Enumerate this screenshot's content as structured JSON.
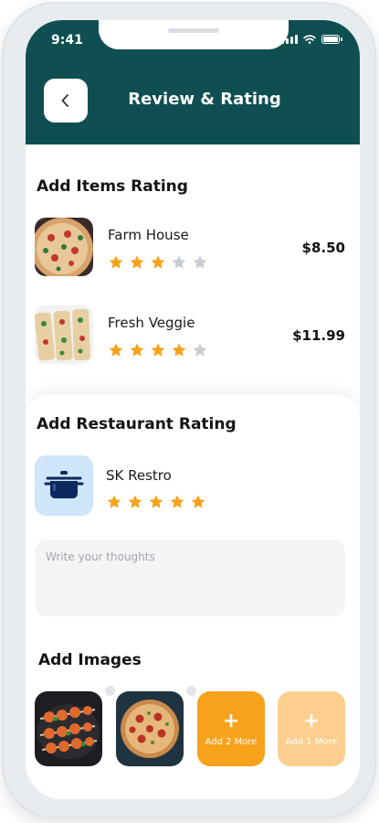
{
  "status_bar": {
    "time": "9:41"
  },
  "header": {
    "title": "Review & Rating"
  },
  "items_section": {
    "title": "Add Items Rating",
    "items": [
      {
        "name": "Farm House",
        "price": "$8.50",
        "rating": 3,
        "max_rating": 5
      },
      {
        "name": "Fresh Veggie",
        "price": "$11.99",
        "rating": 4,
        "max_rating": 5
      }
    ]
  },
  "restaurant_section": {
    "title": "Add Restaurant Rating",
    "restaurant": {
      "name": "SK Restro",
      "rating": 5,
      "max_rating": 5
    },
    "thoughts_placeholder": "Write your thoughts"
  },
  "images_section": {
    "title": "Add Images",
    "add_more_labels": [
      "Add 2 More",
      "Add 1 More"
    ]
  },
  "colors": {
    "header_bg": "#0f4f52",
    "star_filled": "#f7a21b",
    "star_empty": "#c9ccd1",
    "accent": "#f7a21b",
    "accent_light": "#fccf8f"
  }
}
